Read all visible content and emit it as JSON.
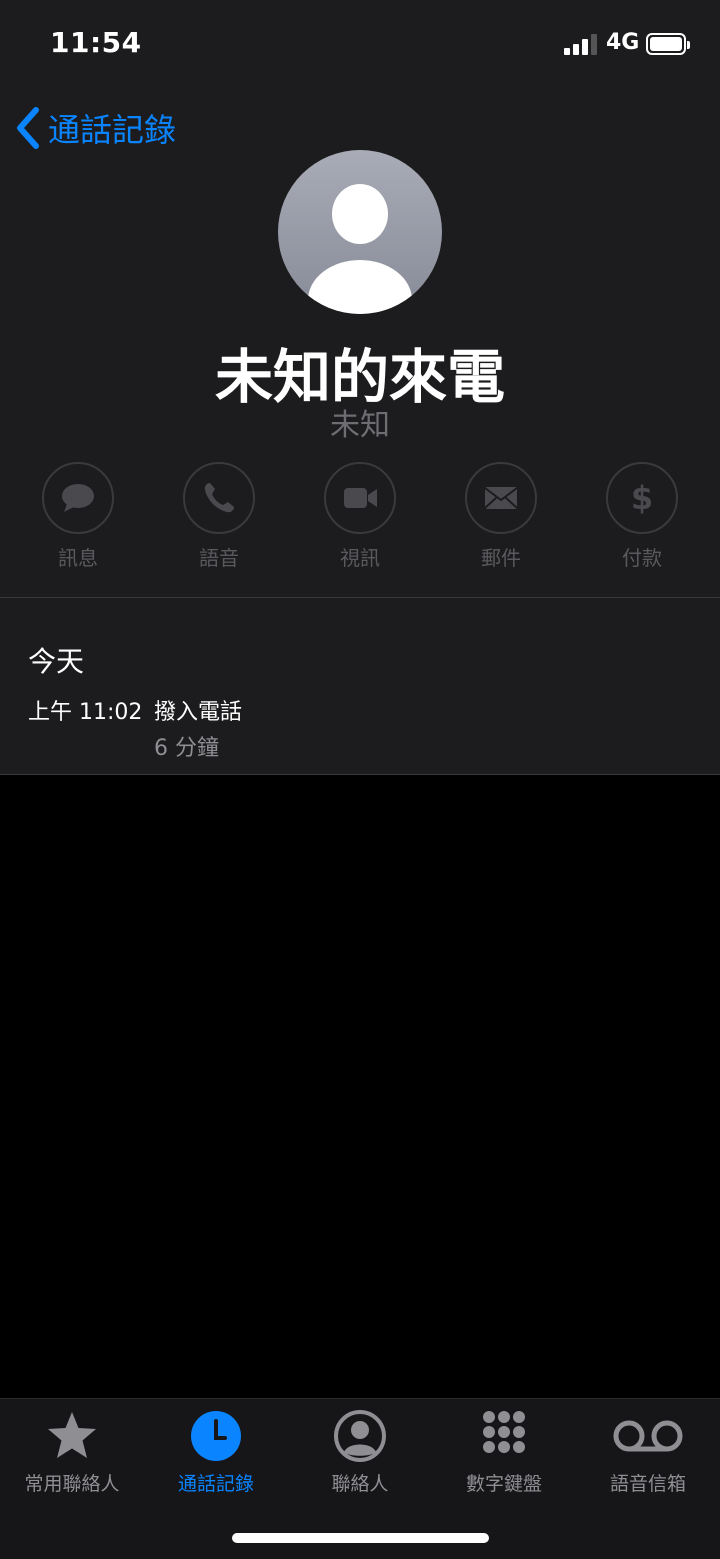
{
  "status_bar": {
    "time": "11:54",
    "network": "4G"
  },
  "nav": {
    "back_label": "通話記錄"
  },
  "contact": {
    "name": "未知的來電",
    "subtitle": "未知"
  },
  "actions": [
    {
      "label": "訊息",
      "icon": "message-bubble-icon"
    },
    {
      "label": "語音",
      "icon": "phone-icon"
    },
    {
      "label": "視訊",
      "icon": "video-camera-icon"
    },
    {
      "label": "郵件",
      "icon": "envelope-icon"
    },
    {
      "label": "付款",
      "icon": "dollar-icon"
    }
  ],
  "history": {
    "day": "今天",
    "entries": [
      {
        "time": "上午 11:02",
        "type": "撥入電話",
        "duration": "6 分鐘"
      }
    ]
  },
  "tabs": [
    {
      "label": "常用聯絡人",
      "icon": "star-icon",
      "active": false
    },
    {
      "label": "通話記錄",
      "icon": "clock-icon",
      "active": true
    },
    {
      "label": "聯絡人",
      "icon": "person-circle-icon",
      "active": false
    },
    {
      "label": "數字鍵盤",
      "icon": "keypad-icon",
      "active": false
    },
    {
      "label": "語音信箱",
      "icon": "voicemail-icon",
      "active": false
    }
  ],
  "colors": {
    "accent": "#0a84ff",
    "background": "#1c1c1e",
    "disabled": "#5a5a5e"
  }
}
